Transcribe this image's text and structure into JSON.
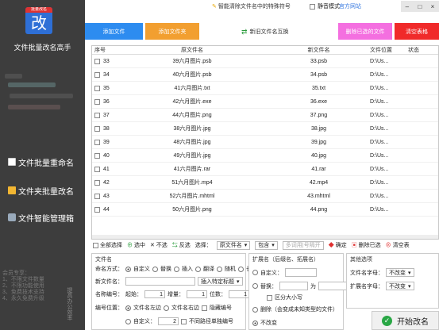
{
  "app": {
    "title": "文件批量改名高手",
    "logo_tag": "批量改名",
    "logo_glyph": "改"
  },
  "topbar": {
    "hint": "智能清除文件名中的特殊符号",
    "mute": "静音模式",
    "site": "官方网站",
    "minimize": "–",
    "restore": "□",
    "close": "×"
  },
  "toolbar": {
    "add_file": "添加文件",
    "add_folder": "添加文件夹",
    "swap": "新旧文件名互换",
    "delete_selected": "删除已选的文件",
    "clear_table": "清空表格"
  },
  "table": {
    "headers": [
      "序号",
      "原文件名",
      "新文件名",
      "文件位置",
      "状态"
    ],
    "rows": [
      {
        "no": "33",
        "orig": "39六月图片.psb",
        "new": "33.psb",
        "loc": "D:\\Us..."
      },
      {
        "no": "34",
        "orig": "40六月图片.psb",
        "new": "34.psb",
        "loc": "D:\\Us..."
      },
      {
        "no": "35",
        "orig": "41六月图片.txt",
        "new": "35.txt",
        "loc": "D:\\Us..."
      },
      {
        "no": "36",
        "orig": "42六月图片.exe",
        "new": "36.exe",
        "loc": "D:\\Us..."
      },
      {
        "no": "37",
        "orig": "44六月图片.png",
        "new": "37.png",
        "loc": "D:\\Us..."
      },
      {
        "no": "38",
        "orig": "38六月图片.jpg",
        "new": "38.jpg",
        "loc": "D:\\Us..."
      },
      {
        "no": "39",
        "orig": "48六月图片.jpg",
        "new": "39.jpg",
        "loc": "D:\\Us..."
      },
      {
        "no": "40",
        "orig": "49六月图片.jpg",
        "new": "40.jpg",
        "loc": "D:\\Us..."
      },
      {
        "no": "41",
        "orig": "41六月图片.rar",
        "new": "41.rar",
        "loc": "D:\\Us..."
      },
      {
        "no": "42",
        "orig": "51六月图片.mp4",
        "new": "42.mp4",
        "loc": "D:\\Us..."
      },
      {
        "no": "43",
        "orig": "52六月图片.mhtml",
        "new": "43.mhtml",
        "loc": "D:\\Us..."
      },
      {
        "no": "44",
        "orig": "50六月图片.png",
        "new": "44.png",
        "loc": "D:\\Us..."
      }
    ]
  },
  "nav": {
    "rename": "文件批量重命名",
    "folder": "文件夹批量改名",
    "tools": "文件智能管理箱"
  },
  "member": {
    "title": "会员专享：",
    "lines": [
      "1、不限文件数量",
      "2、不限功能使用",
      "3、免费技术支持",
      "4、永久免费升级"
    ],
    "vertical": "提高办公效率"
  },
  "selbar": {
    "select_all": "全部选择",
    "select": "选中",
    "unselect": "不选",
    "invert": "反选",
    "choose": "选择：",
    "by": "原文件名",
    "contains": "包含",
    "placeholder": "多词用|号隔开",
    "confirm": "确定",
    "del_sel": "删除已选",
    "clear": "清空表"
  },
  "name_panel": {
    "title": "文件名",
    "mode_label": "命名方式：",
    "modes": [
      "自定义",
      "替换",
      "插入",
      "翻译",
      "随机",
      "长度"
    ],
    "new_name_label": "新文件名：",
    "insert_mode": "插入特定标题",
    "num_label": "名称编号：",
    "start_label": "起始：",
    "start": "1",
    "step_label": "增量：",
    "step": "1",
    "digits_label": "位数：",
    "digits": "1",
    "pos_label": "编号位置：",
    "pos_left": "文件名左边",
    "pos_right": "文件名右边",
    "hide_num": "隐藏编号",
    "custom": "自定义：",
    "custom_val": "2",
    "no_seq": "不同路径单独编号"
  },
  "ext_panel": {
    "title": "扩展名（后缀名、拓展名）",
    "custom": "自定义：",
    "replace": "替换：",
    "to": "为",
    "case": "区分大小写",
    "delete": "删除（会变成未知类型的文件）",
    "unchanged": "不改变"
  },
  "other_panel": {
    "title": "其他选项",
    "case_label": "文件名字母：",
    "case_val": "不改变",
    "ext_label": "扩展名字母：",
    "ext_val": "不改变"
  },
  "start": {
    "label": "开始改名"
  }
}
